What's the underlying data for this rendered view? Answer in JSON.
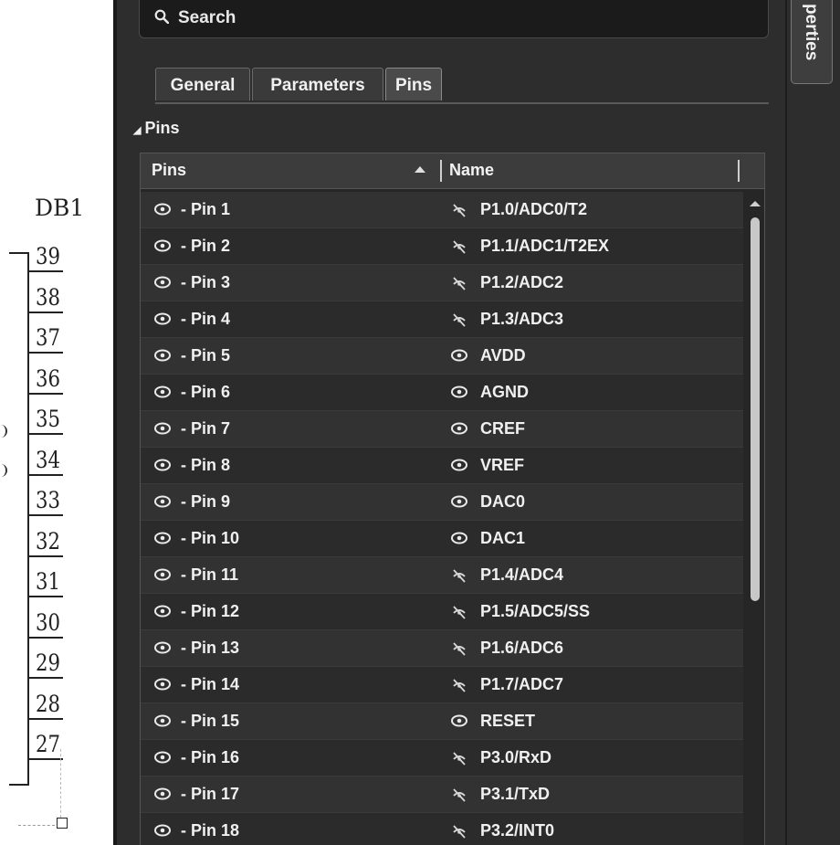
{
  "schematic": {
    "designator": "DB1",
    "pin_numbers": [
      "39",
      "38",
      "37",
      "36",
      "35",
      "34",
      "33",
      "32",
      "31",
      "30",
      "29",
      "28",
      "27"
    ]
  },
  "search": {
    "placeholder": "Search"
  },
  "tabs": [
    {
      "label": "General",
      "active": false
    },
    {
      "label": "Parameters",
      "active": false
    },
    {
      "label": "Pins",
      "active": true
    }
  ],
  "section": {
    "title": "Pins"
  },
  "grid": {
    "columns": [
      "Pins",
      "Name"
    ],
    "sort": {
      "column": "Pins",
      "direction": "ascending"
    },
    "rows": [
      {
        "pin": "- Pin 1",
        "name": "P1.0/ADC0/T2",
        "name_icon": "eye-hidden-icon"
      },
      {
        "pin": "- Pin 2",
        "name": "P1.1/ADC1/T2EX",
        "name_icon": "eye-hidden-icon"
      },
      {
        "pin": "- Pin 3",
        "name": "P1.2/ADC2",
        "name_icon": "eye-hidden-icon"
      },
      {
        "pin": "- Pin 4",
        "name": "P1.3/ADC3",
        "name_icon": "eye-hidden-icon"
      },
      {
        "pin": "- Pin 5",
        "name": "AVDD",
        "name_icon": "eye-icon"
      },
      {
        "pin": "- Pin 6",
        "name": "AGND",
        "name_icon": "eye-icon"
      },
      {
        "pin": "- Pin 7",
        "name": "CREF",
        "name_icon": "eye-icon"
      },
      {
        "pin": "- Pin 8",
        "name": "VREF",
        "name_icon": "eye-icon"
      },
      {
        "pin": "- Pin 9",
        "name": "DAC0",
        "name_icon": "eye-icon"
      },
      {
        "pin": "- Pin 10",
        "name": "DAC1",
        "name_icon": "eye-icon"
      },
      {
        "pin": "- Pin 11",
        "name": "P1.4/ADC4",
        "name_icon": "eye-hidden-icon"
      },
      {
        "pin": "- Pin 12",
        "name": "P1.5/ADC5/SS",
        "name_icon": "eye-hidden-icon"
      },
      {
        "pin": "- Pin 13",
        "name": "P1.6/ADC6",
        "name_icon": "eye-hidden-icon"
      },
      {
        "pin": "- Pin 14",
        "name": "P1.7/ADC7",
        "name_icon": "eye-hidden-icon"
      },
      {
        "pin": "- Pin 15",
        "name": "RESET",
        "name_icon": "eye-icon"
      },
      {
        "pin": "- Pin 16",
        "name": "P3.0/RxD",
        "name_icon": "eye-hidden-icon"
      },
      {
        "pin": "- Pin 17",
        "name": "P3.1/TxD",
        "name_icon": "eye-hidden-icon"
      },
      {
        "pin": "- Pin 18",
        "name": "P3.2/INT0",
        "name_icon": "eye-hidden-icon"
      }
    ]
  },
  "side_panel": {
    "tab_label": "perties"
  },
  "colors": {
    "panel_bg": "#2d2d2d",
    "grid_bg": "#262626",
    "text": "#f0f0f0",
    "schematic_bg": "#ffffff"
  }
}
